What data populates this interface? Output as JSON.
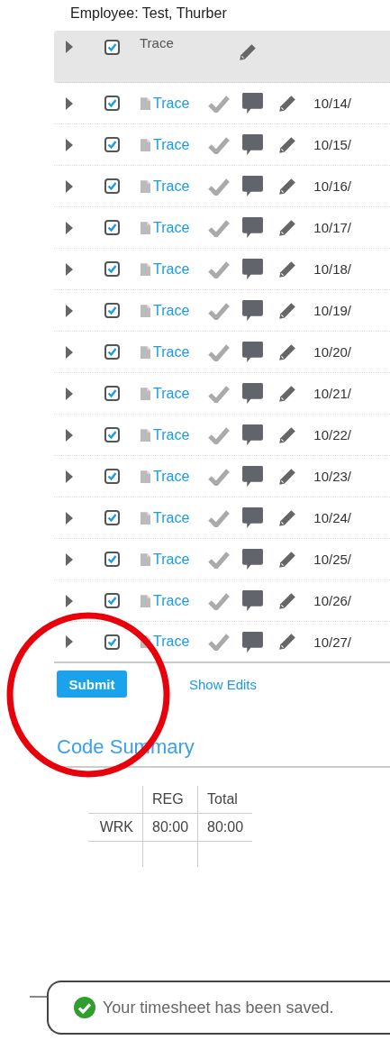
{
  "employee_label": "Employee: Test, Thurber",
  "header": {
    "checked": true,
    "label": "Trace"
  },
  "rows": [
    {
      "checked": true,
      "link": "Trace",
      "date": "10/14/"
    },
    {
      "checked": true,
      "link": "Trace",
      "date": "10/15/"
    },
    {
      "checked": true,
      "link": "Trace",
      "date": "10/16/"
    },
    {
      "checked": true,
      "link": "Trace",
      "date": "10/17/"
    },
    {
      "checked": true,
      "link": "Trace",
      "date": "10/18/"
    },
    {
      "checked": true,
      "link": "Trace",
      "date": "10/19/"
    },
    {
      "checked": true,
      "link": "Trace",
      "date": "10/20/"
    },
    {
      "checked": true,
      "link": "Trace",
      "date": "10/21/"
    },
    {
      "checked": true,
      "link": "Trace",
      "date": "10/22/"
    },
    {
      "checked": true,
      "link": "Trace",
      "date": "10/23/"
    },
    {
      "checked": true,
      "link": "Trace",
      "date": "10/24/"
    },
    {
      "checked": true,
      "link": "Trace",
      "date": "10/25/"
    },
    {
      "checked": true,
      "link": "Trace",
      "date": "10/26/"
    },
    {
      "checked": true,
      "link": "Trace",
      "date": "10/27/"
    }
  ],
  "buttons": {
    "submit": "Submit",
    "show_edits": "Show Edits"
  },
  "code_summary": {
    "title": "Code Summary",
    "columns": [
      "",
      "REG",
      "Total"
    ],
    "rows": [
      [
        "WRK",
        "80:00",
        "80:00"
      ]
    ]
  },
  "toast": {
    "message": "Your timesheet has been saved."
  }
}
